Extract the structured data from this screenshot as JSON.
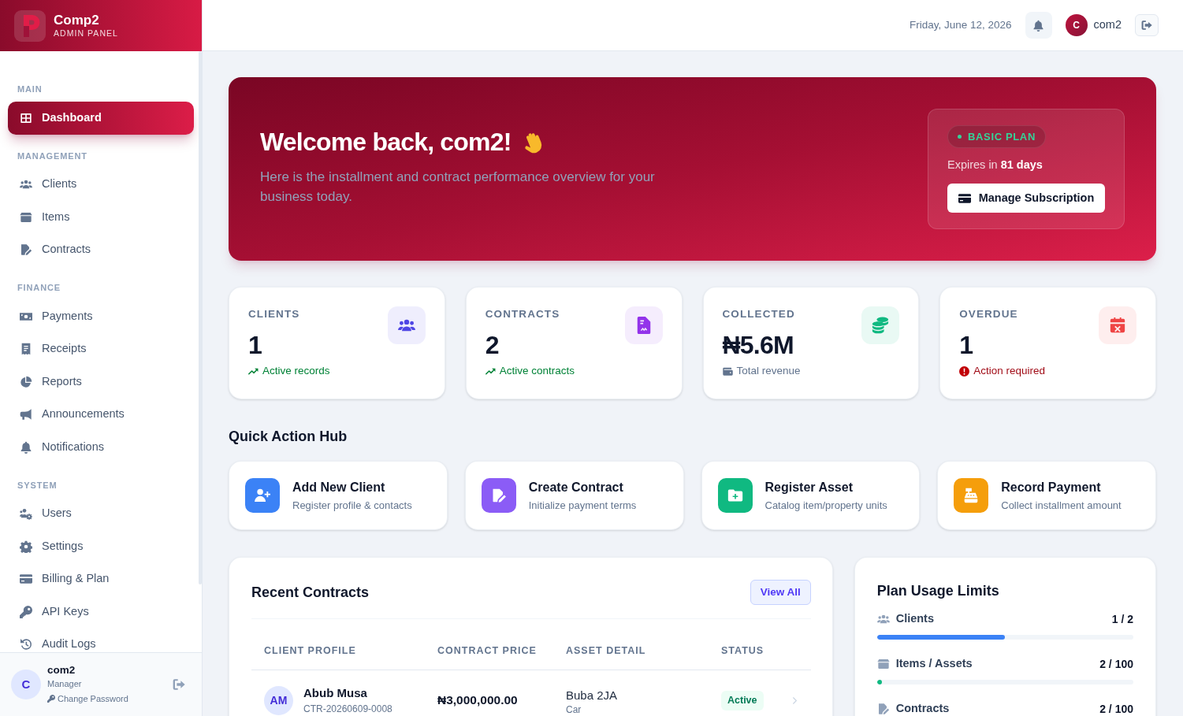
{
  "brand": {
    "name": "Comp2",
    "subtitle": "ADMIN PANEL"
  },
  "sidebar": {
    "sections": [
      {
        "title": "MAIN",
        "items": [
          {
            "label": "Dashboard",
            "selected": true
          }
        ]
      },
      {
        "title": "MANAGEMENT",
        "items": [
          {
            "label": "Clients",
            "selected": false
          },
          {
            "label": "Items",
            "selected": false
          },
          {
            "label": "Contracts",
            "selected": false
          }
        ]
      },
      {
        "title": "FINANCE",
        "items": [
          {
            "label": "Payments",
            "selected": false
          },
          {
            "label": "Receipts",
            "selected": false
          },
          {
            "label": "Reports",
            "selected": false
          },
          {
            "label": "Announcements",
            "selected": false
          },
          {
            "label": "Notifications",
            "selected": false
          }
        ]
      },
      {
        "title": "SYSTEM",
        "items": [
          {
            "label": "Users",
            "selected": false
          },
          {
            "label": "Settings",
            "selected": false
          },
          {
            "label": "Billing & Plan",
            "selected": false
          },
          {
            "label": "API Keys",
            "selected": false
          },
          {
            "label": "Audit Logs",
            "selected": false
          }
        ]
      }
    ],
    "user": {
      "initial": "C",
      "name": "com2",
      "role": "Manager",
      "link": "Change Password"
    }
  },
  "header": {
    "date": "Friday, June 12, 2026",
    "user_initial": "C",
    "user_name": "com2"
  },
  "banner": {
    "title": "Welcome back, com2!",
    "subtitle": "Here is the installment and contract performance overview for your business today.",
    "plan": {
      "badge": "BASIC PLAN",
      "expiry": "Expires in **81 days**",
      "button": "Manage Subscription"
    }
  },
  "stats": [
    {
      "label": "CLIENTS",
      "value": "1",
      "note": "Active records",
      "kind": "trend",
      "color": "#4f46e5"
    },
    {
      "label": "CONTRACTS",
      "value": "2",
      "note": "Active contracts",
      "kind": "trend",
      "color": "#9333ea"
    },
    {
      "label": "COLLECTED",
      "value": "₦5.6M",
      "note": "Total revenue",
      "kind": "info",
      "color": "#10b981"
    },
    {
      "label": "OVERDUE",
      "value": "1",
      "note": "Action required",
      "kind": "alert",
      "color": "#ef4444"
    }
  ],
  "quick_actions": {
    "title": "Quick Action Hub",
    "items": [
      {
        "title": "Add New Client",
        "description": "Register profile & contacts",
        "color": "#3b82f6"
      },
      {
        "title": "Create Contract",
        "description": "Initialize payment terms",
        "color": "#8b5cf6"
      },
      {
        "title": "Register Asset",
        "description": "Catalog item/property units",
        "color": "#10b981"
      },
      {
        "title": "Record Payment",
        "description": "Collect installment amount",
        "color": "#f59e0b"
      }
    ]
  },
  "recent_contracts": {
    "title": "Recent Contracts",
    "action": "View All",
    "columns": [
      "CLIENT PROFILE",
      "CONTRACT PRICE",
      "ASSET DETAIL",
      "STATUS"
    ],
    "rows": [
      {
        "initials": "AM",
        "client": "Abub Musa",
        "reference": "CTR-20260609-0008",
        "price": "₦3,000,000.00",
        "asset": "Buba 2JA",
        "asset_type": "Car",
        "status": "Active"
      }
    ]
  },
  "plan_usage": {
    "title": "Plan Usage Limits",
    "items": [
      {
        "label": "Clients",
        "count": "1 / 2",
        "level": 0.5,
        "color": "#3b82f6"
      },
      {
        "label": "Items / Assets",
        "count": "2 / 100",
        "level": 0.02,
        "color": "#10b981"
      },
      {
        "label": "Contracts",
        "count": "2 / 100"
      }
    ]
  }
}
